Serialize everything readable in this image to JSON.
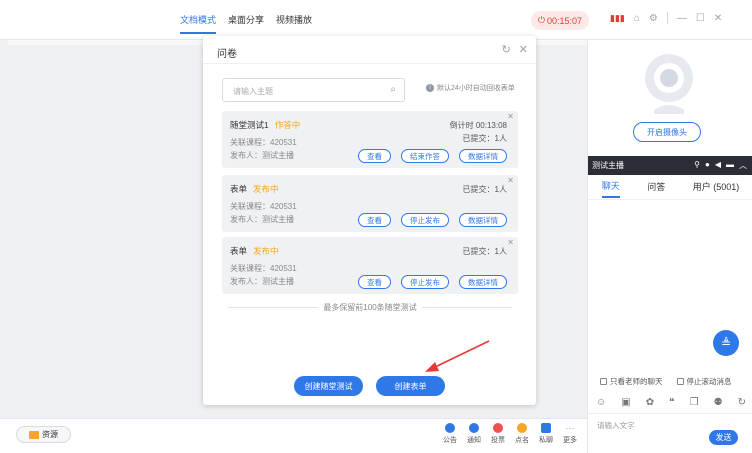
{
  "top": {
    "tabs": [
      "文档模式",
      "桌面分享",
      "视频播放"
    ],
    "active_tab": 0,
    "timer": "00:15:07"
  },
  "dialog": {
    "title": "问卷",
    "search_placeholder": "请输入主题",
    "auto_note": "默认24小时自动回收表单",
    "cards": [
      {
        "name": "随堂测试1",
        "state": "作答中",
        "course": "关联课程：420531",
        "publisher": "发布人：测试主播",
        "info1": "倒计时 00:13:08",
        "info2": "已提交：1人",
        "buttons": [
          "查看",
          "结束作答",
          "数据详情"
        ]
      },
      {
        "name": "表单",
        "state": "发布中",
        "course": "关联课程：420531",
        "publisher": "发布人：测试主播",
        "info1": "已提交：1人",
        "info2": "",
        "buttons": [
          "查看",
          "停止发布",
          "数据详情"
        ]
      },
      {
        "name": "表单",
        "state": "发布中",
        "course": "关联课程：420531",
        "publisher": "发布人：测试主播",
        "info1": "已提交：1人",
        "info2": "",
        "buttons": [
          "查看",
          "停止发布",
          "数据详情"
        ]
      }
    ],
    "footer_note": "最多保留前100条随堂测试",
    "create_test_label": "创建随堂测试",
    "create_form_label": "创建表单"
  },
  "right_panel": {
    "camera_button": "开启摄像头",
    "host_name": "测试主播",
    "chat_tabs": [
      "聊天",
      "问答",
      "用户 (5001)"
    ],
    "check1": "只看老师的聊天",
    "check2": "停止滚动消息",
    "input_placeholder": "请输入文字",
    "send_label": "发送"
  },
  "bottom": {
    "resource_label": "资源",
    "tools": [
      {
        "label": "公告",
        "icon": "bell-icon",
        "color": "#2f78e8"
      },
      {
        "label": "通知",
        "icon": "message-icon",
        "color": "#2f78e8"
      },
      {
        "label": "投票",
        "icon": "vote-icon",
        "color": "#ef5350"
      },
      {
        "label": "点名",
        "icon": "rollcall-icon",
        "color": "#f5a623"
      },
      {
        "label": "私聊",
        "icon": "private-chat-icon",
        "color": "#2f78e8"
      },
      {
        "label": "更多",
        "icon": "more-icon",
        "color": "#9aa3b2"
      }
    ]
  }
}
